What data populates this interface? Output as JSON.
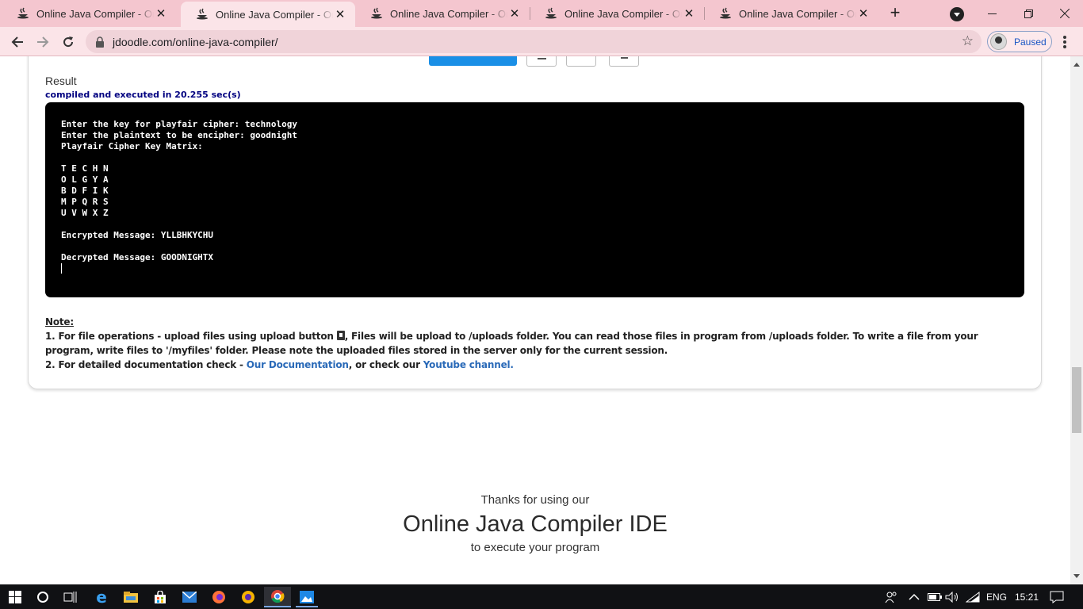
{
  "browser": {
    "tabs": [
      {
        "title": "Online Java Compiler - Online Java IDE",
        "active": false
      },
      {
        "title": "Online Java Compiler - Online Java IDE",
        "active": true
      },
      {
        "title": "Online Java Compiler - Online Java IDE",
        "active": false
      },
      {
        "title": "Online Java Compiler - Online Java IDE",
        "active": false
      },
      {
        "title": "Online Java Compiler - Online Java IDE",
        "active": false
      }
    ],
    "url": "jdoodle.com/online-java-compiler/",
    "profile_label": "Paused"
  },
  "result": {
    "label": "Result",
    "exec_info": "compiled and executed in 20.255 sec(s)",
    "output_lines": [
      "Enter the key for playfair cipher: technology",
      "Enter the plaintext to be encipher: goodnight",
      "Playfair Cipher Key Matrix:",
      "",
      "T E C H N",
      "O L G Y A",
      "B D F I K",
      "M P Q R S",
      "U V W X Z",
      "",
      "Encrypted Message: YLLBHKYCHU",
      "",
      "Decrypted Message: GOODNIGHTX"
    ]
  },
  "note": {
    "heading": "Note:",
    "item1_part1": "1. For file operations - upload files using upload button ",
    "item1_part2": ", Files will be upload to /uploads folder. You can read those files in program from /uploads folder. To write a file from your program, write files to '/myfiles' folder. Please note the uploaded files stored in the server only for the current session.",
    "item2_part1": "2. For detailed documentation check - ",
    "docs_link": "Our Documentation",
    "item2_part2": ", or check our ",
    "youtube_link": "Youtube channel."
  },
  "footer": {
    "line1": "Thanks for using our",
    "line2": "Online Java Compiler IDE",
    "line3": "to execute your program"
  },
  "taskbar": {
    "language": "ENG",
    "time": "15:21"
  },
  "colors": {
    "tabstrip": "#f4c6cf",
    "toolbar": "#fbe4e8",
    "execute_button": "#1a8fe6",
    "exec_info_text": "#000080",
    "link": "#2a6ab8"
  }
}
